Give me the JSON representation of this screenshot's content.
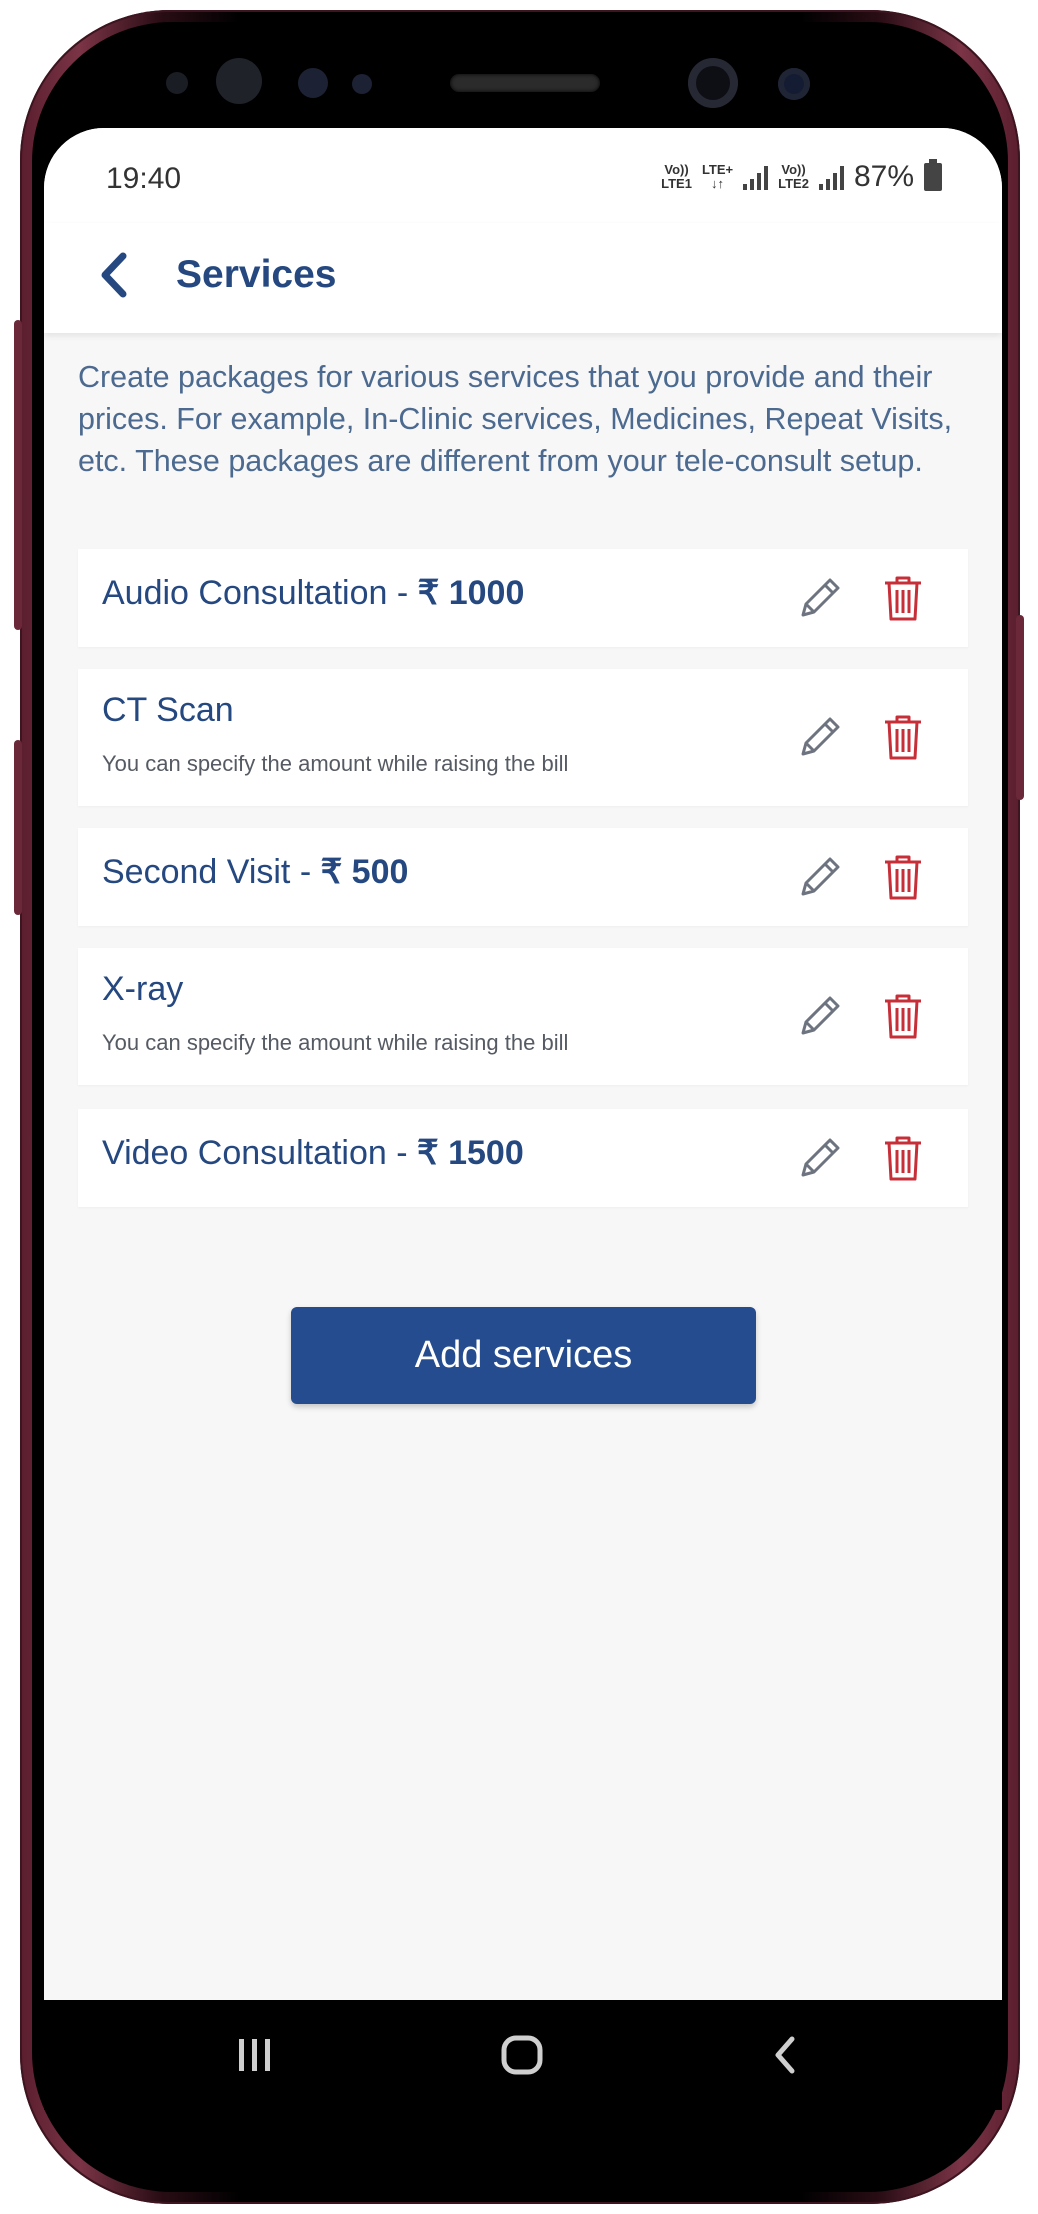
{
  "status_bar": {
    "time": "19:40",
    "network1_top": "Vo))",
    "network1_bottom": "LTE1",
    "network_type": "LTE+",
    "network2_top": "Vo))",
    "network2_bottom": "LTE2",
    "battery": "87%"
  },
  "header": {
    "title": "Services",
    "back_icon": "chevron-left-icon"
  },
  "intro": "Create packages for various services that you provide and their prices. For example, In-Clinic services, Medicines, Repeat Visits, etc. These packages are different from your tele-consult setup.",
  "services": [
    {
      "name": "Audio Consultation - ",
      "price": "₹ 1000",
      "subtitle": ""
    },
    {
      "name": "CT Scan",
      "price": "",
      "subtitle": "You can specify the amount while raising the bill"
    },
    {
      "name": "Second Visit - ",
      "price": "₹ 500",
      "subtitle": ""
    },
    {
      "name": "X-ray",
      "price": "",
      "subtitle": "You can specify the amount while raising the bill"
    },
    {
      "name": "Video Consultation - ",
      "price": "₹ 1500",
      "subtitle": ""
    }
  ],
  "add_button_label": "Add services",
  "colors": {
    "primary": "#244c8f",
    "title_text": "#24487f",
    "delete_red": "#c62f38",
    "edit_gray": "#6d7480",
    "background": "#f7f7f7"
  },
  "icons": {
    "edit": "pencil-icon",
    "delete": "trash-icon",
    "nav_recent": "recent-apps-icon",
    "nav_home": "home-icon",
    "nav_back": "back-icon"
  }
}
